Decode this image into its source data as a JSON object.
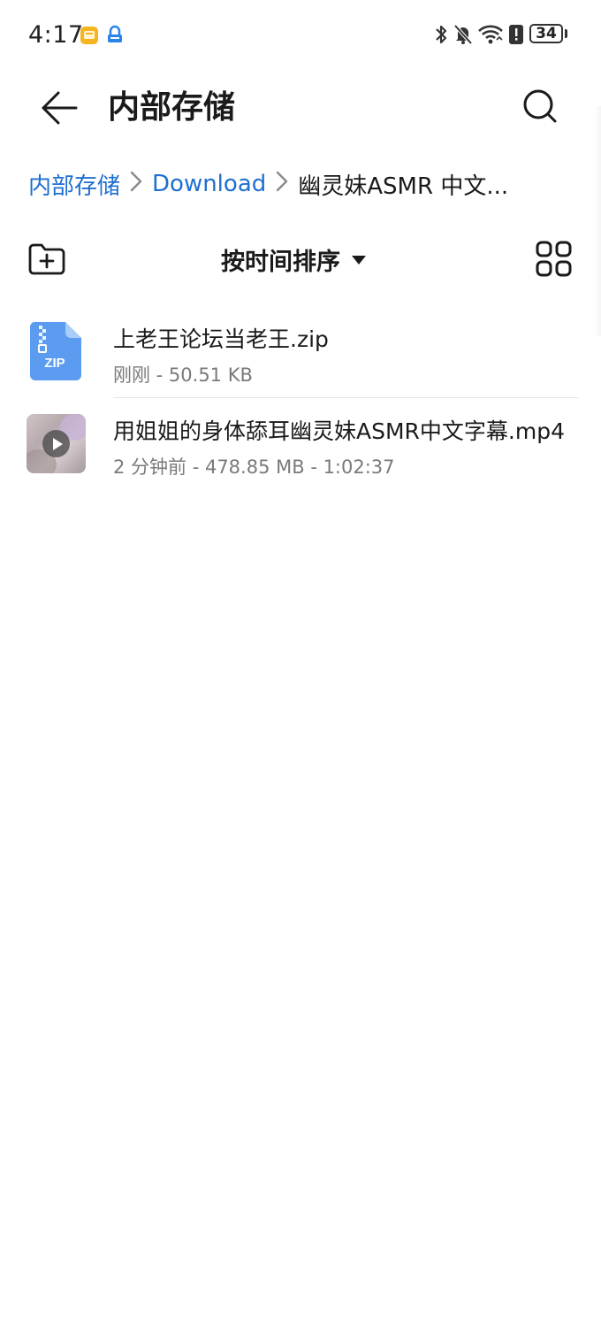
{
  "status_bar": {
    "time": "4:17",
    "battery": "34",
    "icons": [
      "notification-app-icon",
      "vpn-lock-icon",
      "bluetooth-icon",
      "mute-bell-icon",
      "wifi-icon",
      "alert-icon",
      "battery-icon"
    ]
  },
  "header": {
    "title": "内部存储",
    "back_icon": "back-arrow-icon",
    "search_icon": "search-icon"
  },
  "breadcrumb": {
    "items": [
      {
        "label": "内部存储"
      },
      {
        "label": "Download"
      },
      {
        "label": "幽灵妹ASMR 中文..."
      }
    ]
  },
  "toolbar": {
    "new_folder_icon": "new-folder-icon",
    "sort_label": "按时间排序",
    "sort_icon": "caret-down-icon",
    "view_icon": "grid-view-icon"
  },
  "files": [
    {
      "name": "上老王论坛当老王.zip",
      "meta": "刚刚 - 50.51 KB",
      "type_label": "ZIP",
      "icon": "zip-file-icon"
    },
    {
      "name": "用姐姐的身体舔耳幽灵妹ASMR中文字幕.mp4",
      "meta": "2 分钟前 - 478.85 MB - 1:02:37",
      "icon": "video-thumbnail"
    }
  ],
  "colors": {
    "accent": "#1f6fd0",
    "zip_icon": "#5b9bf0",
    "text_primary": "#1a1a1a",
    "text_secondary": "#7a7a7a"
  }
}
